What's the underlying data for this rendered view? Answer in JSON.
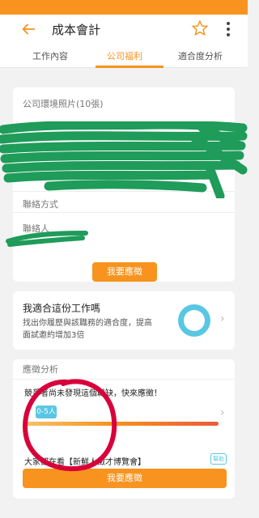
{
  "header": {
    "title": "成本會計"
  },
  "tabs": [
    {
      "label": "工作內容"
    },
    {
      "label": "公司福利"
    },
    {
      "label": "適合度分析"
    }
  ],
  "company": {
    "photos_label": "公司環境照片(10張)"
  },
  "contact": {
    "section_label": "聯絡方式",
    "person_label": "聯絡人",
    "apply_small": "我要應徵"
  },
  "fit": {
    "title": "我適合這份工作嗎",
    "desc": "找出你履歷與該職務的適合度，提高面試邀約增加3倍"
  },
  "analysis": {
    "section_label": "應徵分析",
    "applicants_text": "競爭者尚未發現這個職缺，快來應徵！",
    "badge": "0-5人",
    "progress": 0.08
  },
  "also": {
    "text": "大家都在看【新鮮人徵才博覽會】",
    "help": "幫助"
  },
  "footer": {
    "apply_label": "我要應徵"
  },
  "colors": {
    "accent": "#f7931e",
    "teal": "#58c7e3",
    "scribble": "#1f9b5a",
    "circle": "#d8003a"
  }
}
